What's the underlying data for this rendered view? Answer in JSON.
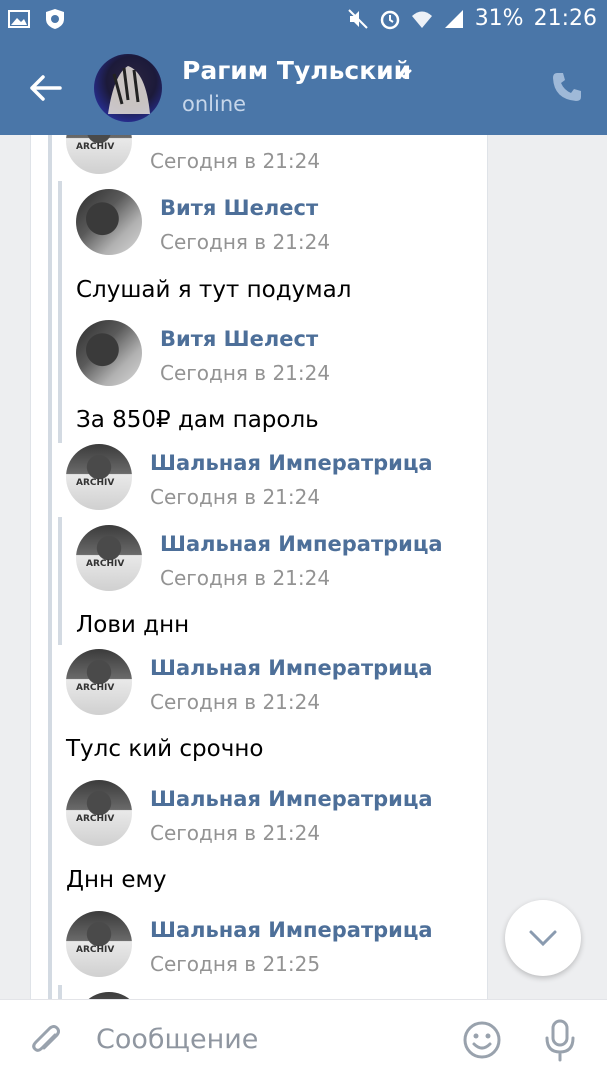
{
  "status_bar": {
    "battery_percent": "31%",
    "time": "21:26"
  },
  "header": {
    "name": "Рагим Тульский",
    "status": "online"
  },
  "messages": [
    {
      "name": "",
      "time": "Сегодня в 21:24",
      "text": ""
    },
    {
      "name": "Витя Шелест",
      "time": "Сегодня в 21:24",
      "text": "Слушай я тут подумал"
    },
    {
      "name": "Витя Шелест",
      "time": "Сегодня в 21:24",
      "text": "За 850₽ дам пароль"
    },
    {
      "name": "Шальная Императрица",
      "time": "Сегодня в 21:24",
      "text": ""
    },
    {
      "name": "Шальная Императрица",
      "time": "Сегодня в 21:24",
      "text": "Лови днн"
    },
    {
      "name": "Шальная Императрица",
      "time": "Сегодня в 21:24",
      "text": "Тулс кий срочно"
    },
    {
      "name": "Шальная Императрица",
      "time": "Сегодня в 21:24",
      "text": "Днн ему"
    },
    {
      "name": "Шальная Императрица",
      "time": "Сегодня в 21:25",
      "text": ""
    }
  ],
  "avatar_print": "ARCHIV",
  "composer": {
    "placeholder": "Сообщение"
  },
  "colors": {
    "header": "#4a76a8",
    "author_name": "#4d6f99",
    "timestamp": "#939393",
    "background": "#edeef0"
  },
  "icons": [
    "image-icon",
    "shield-icon",
    "mute-icon",
    "alarm-icon",
    "wifi-icon",
    "signal-icon",
    "back-arrow-icon",
    "chevron-down-icon",
    "phone-icon",
    "attach-icon",
    "emoji-icon",
    "mic-icon"
  ]
}
